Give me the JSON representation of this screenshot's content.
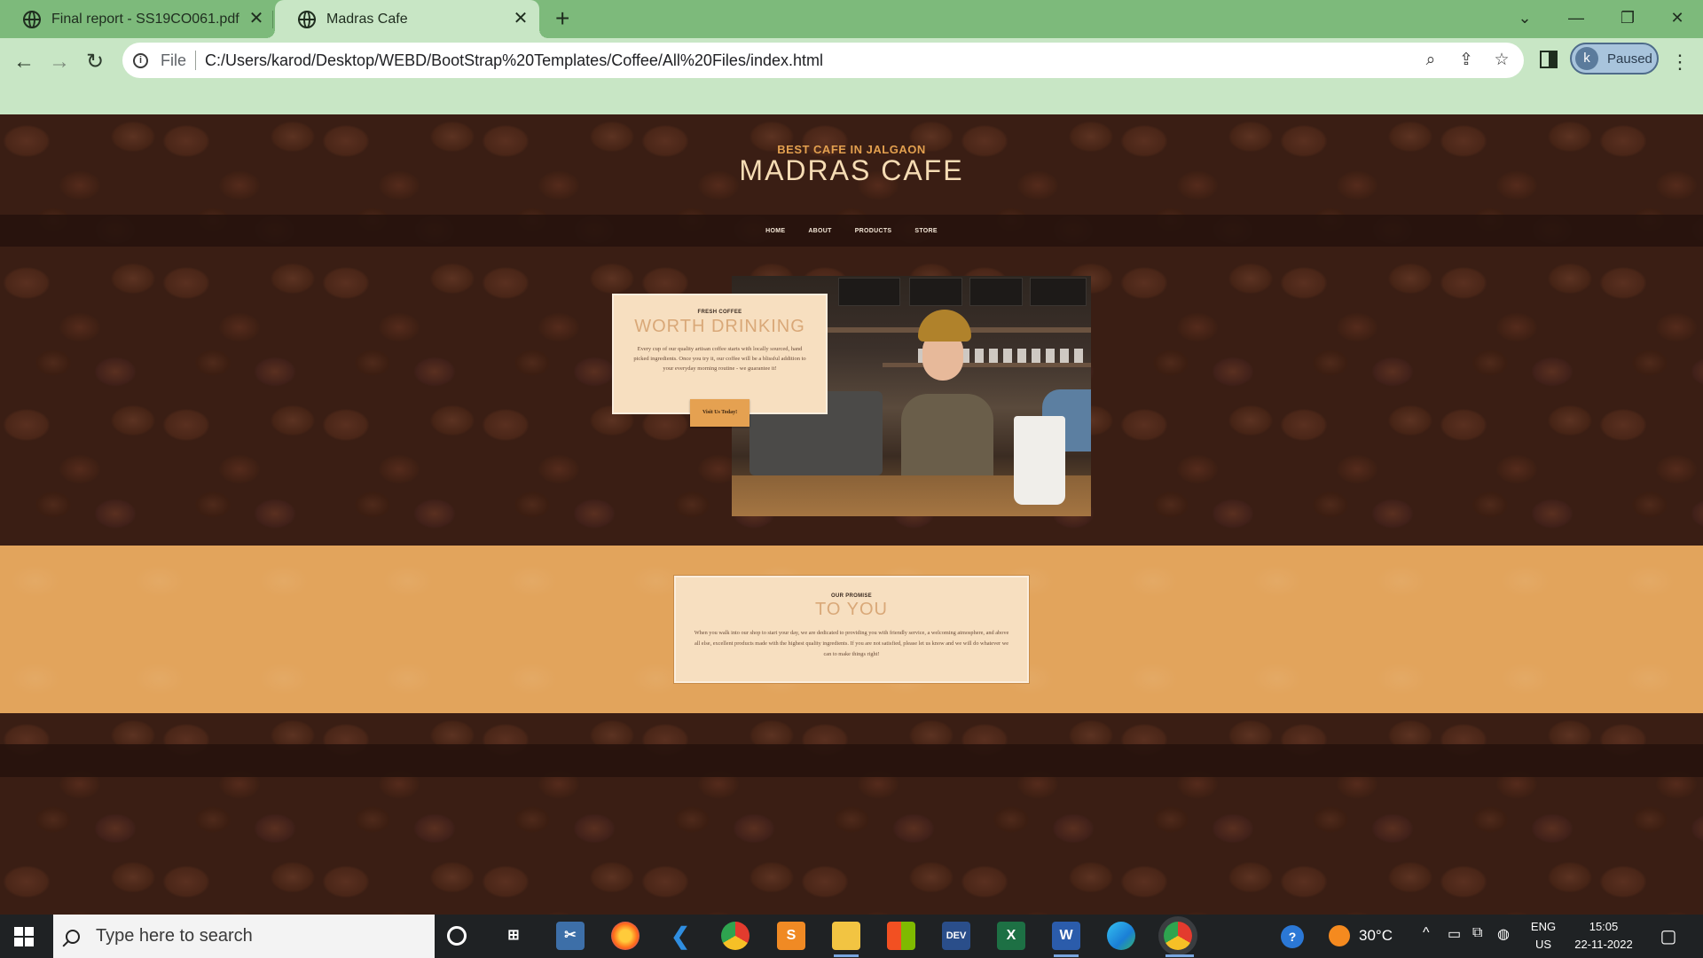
{
  "browser": {
    "tabs": [
      {
        "title": "Final report - SS19CO061.pdf",
        "icon": "globe-icon"
      },
      {
        "title": "Madras Cafe",
        "icon": "globe-icon"
      }
    ],
    "new_tab": "+",
    "address": {
      "scheme": "File",
      "url": "C:/Users/karod/Desktop/WEBD/BootStrap%20Templates/Coffee/All%20Files/index.html"
    },
    "profile": {
      "initial": "k",
      "status": "Paused"
    },
    "colors": {
      "frame": "#7dba7b",
      "toolbar": "#c8e6c5"
    }
  },
  "site": {
    "subtitle": "BEST CAFE IN JALGAON",
    "title": "MADRAS CAFE",
    "nav": [
      "HOME",
      "ABOUT",
      "PRODUCTS",
      "STORE"
    ]
  },
  "intro": {
    "kicker": "FRESH COFFEE",
    "heading": "WORTH DRINKING",
    "body": "Every cup of our quality artisan coffee starts with locally sourced, hand picked ingredients. Once you try it, our coffee will be a blissful addition to your everyday morning routine - we guarantee it!",
    "cta": "Visit Us Today!"
  },
  "promise": {
    "kicker": "OUR PROMISE",
    "heading": "TO YOU",
    "body": "When you walk into our shop to start your day, we are dedicated to providing you with friendly service, a welcoming atmosphere, and above all else, excellent products made with the highest quality ingredients. If you are not satisfied, please let us know and we will do whatever we can to make things right!"
  },
  "colors": {
    "accent": "#e2a45c",
    "card": "#f7dfc0",
    "heading": "#d9a878",
    "dark": "#26120c"
  },
  "taskbar": {
    "search_placeholder": "Type here to search",
    "apps": [
      "cortana-icon",
      "task-view-icon",
      "snipping-tool-icon",
      "firefox-icon",
      "vscode-icon",
      "chrome-icon",
      "sublime-icon",
      "file-explorer-icon",
      "store-icon",
      "dev-icon",
      "excel-icon",
      "word-icon",
      "edge-icon",
      "chrome-profile-icon"
    ],
    "dev_label": "DEV",
    "excel_label": "X",
    "word_label": "W",
    "weather": "30°C",
    "lang_top": "ENG",
    "lang_bottom": "US",
    "time": "15:05",
    "date": "22-11-2022"
  }
}
